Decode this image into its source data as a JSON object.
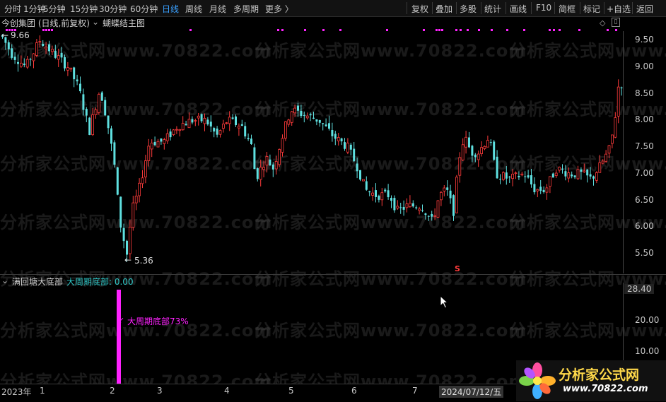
{
  "toolbar": {
    "periods": [
      "分时",
      "1分钟",
      "5分钟",
      "15分钟",
      "30分钟",
      "60分钟",
      "日线",
      "周线",
      "月线",
      "多周期",
      "更多 〉"
    ],
    "active": "日线",
    "right": [
      "复权",
      "叠加",
      "多股",
      "统计",
      "画线",
      "F10",
      "简框",
      "标记",
      "+自选",
      "返回"
    ]
  },
  "main": {
    "stock_title": "今创集团 (日线,前复权)",
    "indicator_title": "蝴蝶结主图",
    "high_label": "9.66",
    "low_label": "5.36",
    "signal_mark": "S",
    "price_axis": [
      "9.50",
      "9.00",
      "8.50",
      "8.00",
      "7.50",
      "7.00",
      "6.50",
      "6.00",
      "5.50"
    ]
  },
  "sub": {
    "title": "满回塘大底部",
    "value_label": "大周期底部: 0.00",
    "annotation": "大周期底部73%",
    "axis": [
      "28.40",
      "20.00",
      "10.00"
    ]
  },
  "dates": [
    "2023年",
    "1",
    "2",
    "3",
    "4",
    "5",
    "6",
    "7",
    "2024/07/12/五"
  ],
  "watermark": "分析家公式网www.70822.com",
  "logo": {
    "title": "分析家公式网",
    "url": "www.70822.com"
  },
  "colors": {
    "up": "#ff3b3b",
    "down": "#5fe0e0",
    "magenta": "#ff22ff",
    "accent": "#39a0ff"
  }
}
